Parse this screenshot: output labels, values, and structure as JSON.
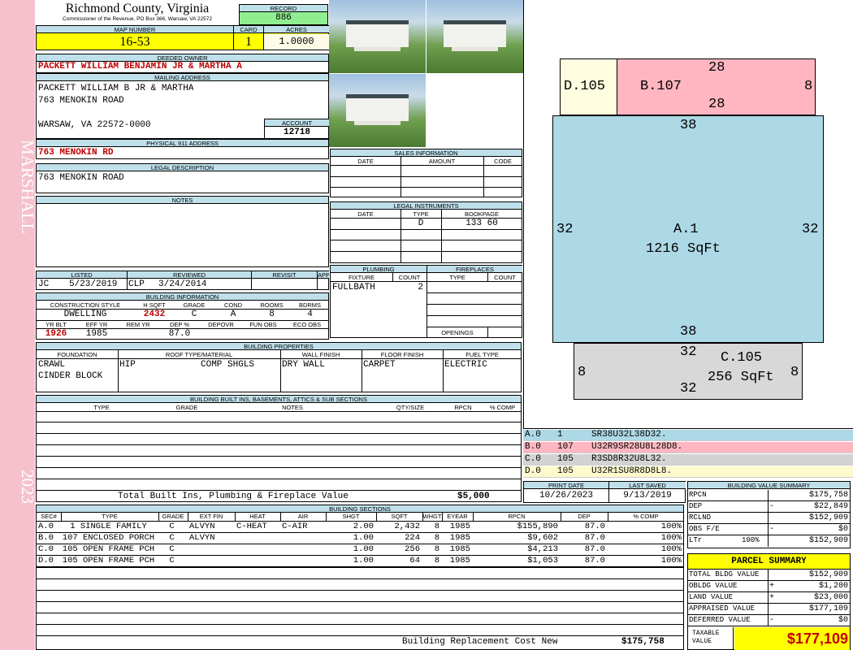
{
  "sidebar": {
    "name": "MARSHALL",
    "year": "2023"
  },
  "header": {
    "county": "Richmond County, Virginia",
    "sub": "Commissioner of the Revenue, PO Box 366, Warsaw, VA 22572",
    "record_label": "RECORD",
    "record": "886",
    "map_label": "MAP NUMBER",
    "map": "16-53",
    "card_label": "CARD",
    "card": "1",
    "acres_label": "ACRES",
    "acres": "1.0000"
  },
  "owner": {
    "label": "DEEDED OWNER",
    "name": "PACKETT WILLIAM BENJAMIN JR & MARTHA A"
  },
  "mailing": {
    "label": "MAILING ADDRESS",
    "line1": "PACKETT WILLIAM B JR & MARTHA",
    "line2": "763 MENOKIN ROAD",
    "line3": "WARSAW, VA 22572-0000",
    "account_label": "ACCOUNT",
    "account": "12718"
  },
  "physical": {
    "label": "PHYSICAL 911 ADDRESS",
    "value": "763 MENOKIN RD"
  },
  "legal": {
    "label": "LEGAL DESCRIPTION",
    "value": "763 MENOKIN ROAD"
  },
  "notes": {
    "label": "NOTES"
  },
  "listing": {
    "listed_label": "LISTED",
    "reviewed_label": "REVIEWED",
    "revisit_label": "REVISIT",
    "appeals_label": "APPEALS",
    "listed_by": "JC",
    "listed_date": "5/23/2019",
    "reviewed_by": "CLP",
    "reviewed_date": "3/24/2014"
  },
  "building_info": {
    "label": "BUILDING INFORMATION",
    "h_style": "CONSTRUCTION STYLE",
    "h_sqft": "H SQFT",
    "h_grade": "GRADE",
    "h_cond": "COND",
    "h_rooms": "ROOMS",
    "h_bdrms": "BDRMS",
    "style": "DWELLING",
    "sqft": "2432",
    "grade": "C",
    "cond": "A",
    "rooms": "8",
    "bdrms": "4",
    "h_yrblt": "YR BLT",
    "h_effyr": "EFF YR",
    "h_remyr": "REM YR",
    "h_dep": "DEP %",
    "h_depovr": "DEPOVR",
    "h_funobs": "FUN OBS",
    "h_ecoobs": "ECO OBS",
    "yrblt": "1926",
    "effyr": "1985",
    "dep": "87.0"
  },
  "sales": {
    "label": "SALES INFORMATION",
    "h_date": "DATE",
    "h_amount": "AMOUNT",
    "h_code": "CODE"
  },
  "legal_inst": {
    "label": "LEGAL INSTRUMENTS",
    "h_date": "DATE",
    "h_type": "TYPE",
    "h_book": "BOOKPAGE",
    "type": "D",
    "book": "133 60"
  },
  "plumbing": {
    "label": "PLUMBING",
    "h_fixture": "FIXTURE",
    "h_count": "COUNT",
    "fixture": "FULLBATH",
    "count": "2"
  },
  "fireplaces": {
    "label": "FIREPLACES",
    "h_type": "TYPE",
    "h_count": "COUNT",
    "openings": "OPENINGS"
  },
  "props": {
    "label": "BUILDING PROPERTIES",
    "h_found": "FOUNDATION",
    "h_roof": "ROOF TYPE/MATERIAL",
    "h_wall": "WALL FINISH",
    "h_floor": "FLOOR FINISH",
    "h_fuel": "FUEL TYPE",
    "found1": "CRAWL",
    "found2": "CINDER BLOCK",
    "roof_type": "HIP",
    "roof_mat": "COMP SHGLS",
    "wall": "DRY WALL",
    "floor": "CARPET",
    "fuel": "ELECTRIC"
  },
  "builtins": {
    "label": "BUILDING BUILT INS, BASEMENTS, ATTICS & SUB SECTIONS",
    "h_type": "TYPE",
    "h_grade": "GRADE",
    "h_notes": "NOTES",
    "h_qty": "QTY/SIZE",
    "h_rpcn": "RPCN",
    "h_comp": "% COMP",
    "total_label": "Total Built Ins, Plumbing & Fireplace Value",
    "total": "$5,000"
  },
  "sections": {
    "label": "BUILDING SECTIONS",
    "headers": [
      "SEC#",
      "TYPE",
      "GRADE",
      "EXT FIN",
      "HEAT",
      "AIR",
      "SHGT",
      "SQFT",
      "WHGT",
      "EYEAR",
      "RPCN",
      "DEP",
      "% COMP"
    ],
    "rows": [
      [
        "A.0",
        "1 SINGLE FAMILY",
        "C",
        "ALVYN",
        "C-HEAT",
        "C-AIR",
        "2.00",
        "2,432",
        "8",
        "1985",
        "$155,890",
        "87.0",
        "100%"
      ],
      [
        "B.0",
        "107 ENCLOSED PORCH",
        "C",
        "ALVYN",
        "",
        "",
        "1.00",
        "224",
        "8",
        "1985",
        "$9,602",
        "87.0",
        "100%"
      ],
      [
        "C.0",
        "105 OPEN FRAME PCH",
        "C",
        "",
        "",
        "",
        "1.00",
        "256",
        "8",
        "1985",
        "$4,213",
        "87.0",
        "100%"
      ],
      [
        "D.0",
        "105 OPEN FRAME PCH",
        "C",
        "",
        "",
        "",
        "1.00",
        "64",
        "8",
        "1985",
        "$1,053",
        "87.0",
        "100%"
      ]
    ],
    "brcn_label": "Building Replacement Cost New",
    "brcn": "$175,758"
  },
  "sketch": {
    "d_label": "D.105",
    "d_side": "8",
    "b_label": "B.107",
    "b_top": "28",
    "b_bottom": "28",
    "b_left": "8",
    "b_right": "8",
    "a_label": "A.1",
    "a_area": "1216 SqFt",
    "a_top": "38",
    "a_bottom": "38",
    "a_left": "32",
    "a_right": "32",
    "c_label": "C.105",
    "c_area": "256 SqFt",
    "c_top": "32",
    "c_bottom": "32",
    "c_left": "8",
    "c_right": "8"
  },
  "segments": [
    {
      "sec": "A.0",
      "code": "1",
      "path": "SR38U32L38D32.",
      "color": "#add8e6"
    },
    {
      "sec": "B.0",
      "code": "107",
      "path": "U32R9SR28U8L28D8.",
      "color": "#ffb6c1"
    },
    {
      "sec": "C.0",
      "code": "105",
      "path": "R3SD8R32U8L32.",
      "color": "#d3d3d3"
    },
    {
      "sec": "D.0",
      "code": "105",
      "path": "U32R1SU8R8D8L8.",
      "color": "#fffacd"
    }
  ],
  "print": {
    "h_print": "PRINT DATE",
    "h_saved": "LAST SAVED",
    "print": "10/26/2023",
    "saved": "9/13/2019"
  },
  "bvs": {
    "label": "BUILDING VALUE SUMMARY",
    "rpcn_l": "RPCN",
    "rpcn": "$175,758",
    "dep_l": "DEP",
    "dep_s": "-",
    "dep": "$22,849",
    "rcnld_l": "RCLND",
    "rcnld": "$152,909",
    "obs_l": "OBS F/E",
    "obs_s": "-",
    "obs": "$0",
    "ltr_l": "LTr",
    "ltr_pct": "100%",
    "ltr": "$152,909"
  },
  "parcel": {
    "label": "PARCEL SUMMARY",
    "tbv_l": "TOTAL BLDG VALUE",
    "tbv": "$152,909",
    "obv_l": "OBLDG VALUE",
    "obv_s": "+",
    "obv": "$1,200",
    "land_l": "LAND VALUE",
    "land_s": "+",
    "land": "$23,000",
    "appr_l": "APPRAISED VALUE",
    "appr": "$177,109",
    "def_l": "DEFERRED VALUE",
    "def_s": "-",
    "def": "$0",
    "tax_l1": "TAXABLE",
    "tax_l2": "VALUE",
    "tax": "$177,109"
  }
}
